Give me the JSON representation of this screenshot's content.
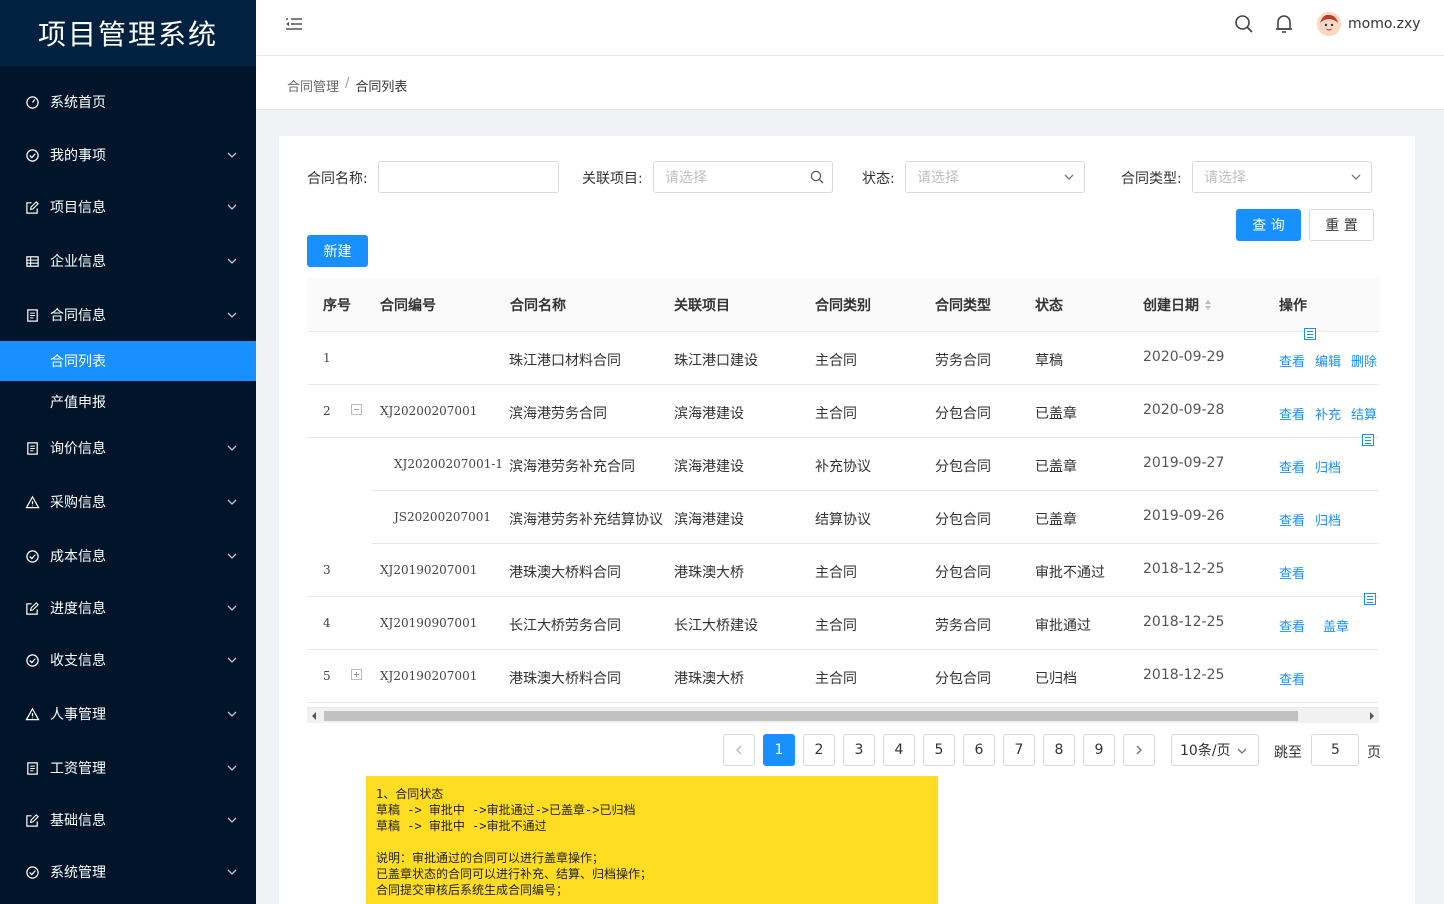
{
  "app": {
    "title": "项目管理系统"
  },
  "sidebar": {
    "items": [
      {
        "label": "系统首页",
        "icon": "dashboard-icon",
        "expandable": false
      },
      {
        "label": "我的事项",
        "icon": "check-circle-icon",
        "expandable": true
      },
      {
        "label": "项目信息",
        "icon": "edit-icon",
        "expandable": true
      },
      {
        "label": "企业信息",
        "icon": "table-icon",
        "expandable": true
      },
      {
        "label": "合同信息",
        "icon": "document-icon",
        "expandable": true
      },
      {
        "label": "合同列表",
        "icon": "",
        "sub": true,
        "active": true
      },
      {
        "label": "产值申报",
        "icon": "",
        "sub": true
      },
      {
        "label": "询价信息",
        "icon": "document-icon",
        "expandable": true
      },
      {
        "label": "采购信息",
        "icon": "warning-icon",
        "expandable": true
      },
      {
        "label": "成本信息",
        "icon": "check-circle-icon",
        "expandable": true
      },
      {
        "label": "进度信息",
        "icon": "edit-icon",
        "expandable": true
      },
      {
        "label": "收支信息",
        "icon": "check-circle-icon",
        "expandable": true
      },
      {
        "label": "人事管理",
        "icon": "warning-icon",
        "expandable": true
      },
      {
        "label": "工资管理",
        "icon": "document-icon",
        "expandable": true
      },
      {
        "label": "基础信息",
        "icon": "edit-icon",
        "expandable": true
      },
      {
        "label": "系统管理",
        "icon": "check-circle-icon",
        "expandable": true
      }
    ]
  },
  "header": {
    "username": "momo.zxy"
  },
  "breadcrumb": {
    "parent": "合同管理",
    "separator": "/",
    "current": "合同列表"
  },
  "filters": {
    "name_label": "合同名称:",
    "name_value": "",
    "project_label": "关联项目:",
    "project_placeholder": "请选择",
    "status_label": "状态:",
    "status_placeholder": "请选择",
    "type_label": "合同类型:",
    "type_placeholder": "请选择",
    "query_label": "查 询",
    "reset_label": "重 置"
  },
  "toolbar": {
    "new_label": "新建"
  },
  "table": {
    "headers": [
      "序号",
      "合同编号",
      "合同名称",
      "关联项目",
      "合同类别",
      "合同类型",
      "状态",
      "创建日期",
      "操作"
    ],
    "rows": [
      {
        "index": "1",
        "code": "",
        "name": "珠江港口材料合同",
        "project": "珠江港口建设",
        "category": "主合同",
        "type": "劳务合同",
        "status": "草稿",
        "date": "2020-09-29",
        "actions": [
          "查看",
          "编辑",
          "删除"
        ]
      },
      {
        "index": "2",
        "code": "XJ20200207001",
        "name": "滨海港劳务合同",
        "project": "滨海港建设",
        "category": "主合同",
        "type": "分包合同",
        "status": "已盖章",
        "date": "2020-09-28",
        "actions": [
          "查看",
          "补充",
          "结算"
        ]
      },
      {
        "index": "",
        "code": "XJ20200207001-1",
        "name": "滨海港劳务补充合同",
        "project": "滨海港建设",
        "category": "补充协议",
        "type": "分包合同",
        "status": "已盖章",
        "date": "2019-09-27",
        "actions": [
          "查看",
          "归档"
        ]
      },
      {
        "index": "",
        "code": "JS20200207001",
        "name": "滨海港劳务补充结算协议",
        "project": "滨海港建设",
        "category": "结算协议",
        "type": "分包合同",
        "status": "已盖章",
        "date": "2019-09-26",
        "actions": [
          "查看",
          "归档"
        ]
      },
      {
        "index": "3",
        "code": "XJ20190207001",
        "name": "港珠澳大桥料合同",
        "project": "港珠澳大桥",
        "category": "主合同",
        "type": "分包合同",
        "status": "审批不通过",
        "date": "2018-12-25",
        "actions": [
          "查看"
        ]
      },
      {
        "index": "4",
        "code": "XJ20190907001",
        "name": "长江大桥劳务合同",
        "project": "长江大桥建设",
        "category": "主合同",
        "type": "劳务合同",
        "status": "审批通过",
        "date": "2018-12-25",
        "actions": [
          "查看",
          "盖章"
        ]
      },
      {
        "index": "5",
        "code": "XJ20190207001",
        "name": "港珠澳大桥料合同",
        "project": "港珠澳大桥",
        "category": "主合同",
        "type": "分包合同",
        "status": "已归档",
        "date": "2018-12-25",
        "actions": [
          "查看"
        ]
      }
    ]
  },
  "pagination": {
    "pages": [
      "1",
      "2",
      "3",
      "4",
      "5",
      "6",
      "7",
      "8",
      "9"
    ],
    "current": "1",
    "page_size": "10条/页",
    "jump_label": "跳至",
    "jump_value": "5",
    "page_suffix": "页"
  },
  "note": {
    "lines": [
      "1、合同状态",
      "草稿 -> 审批中 ->审批通过->已盖章->已归档",
      "草稿 -> 审批中 ->审批不通过",
      "",
      "说明：审批通过的合同可以进行盖章操作；",
      "已盖章状态的合同可以进行补充、结算、归档操作；",
      "合同提交审核后系统生成合同编号；"
    ]
  },
  "colors": {
    "primary": "#1890ff",
    "sidebar_bg": "#001529",
    "logo_bg": "#002140",
    "note_bg": "#ffdd23"
  }
}
